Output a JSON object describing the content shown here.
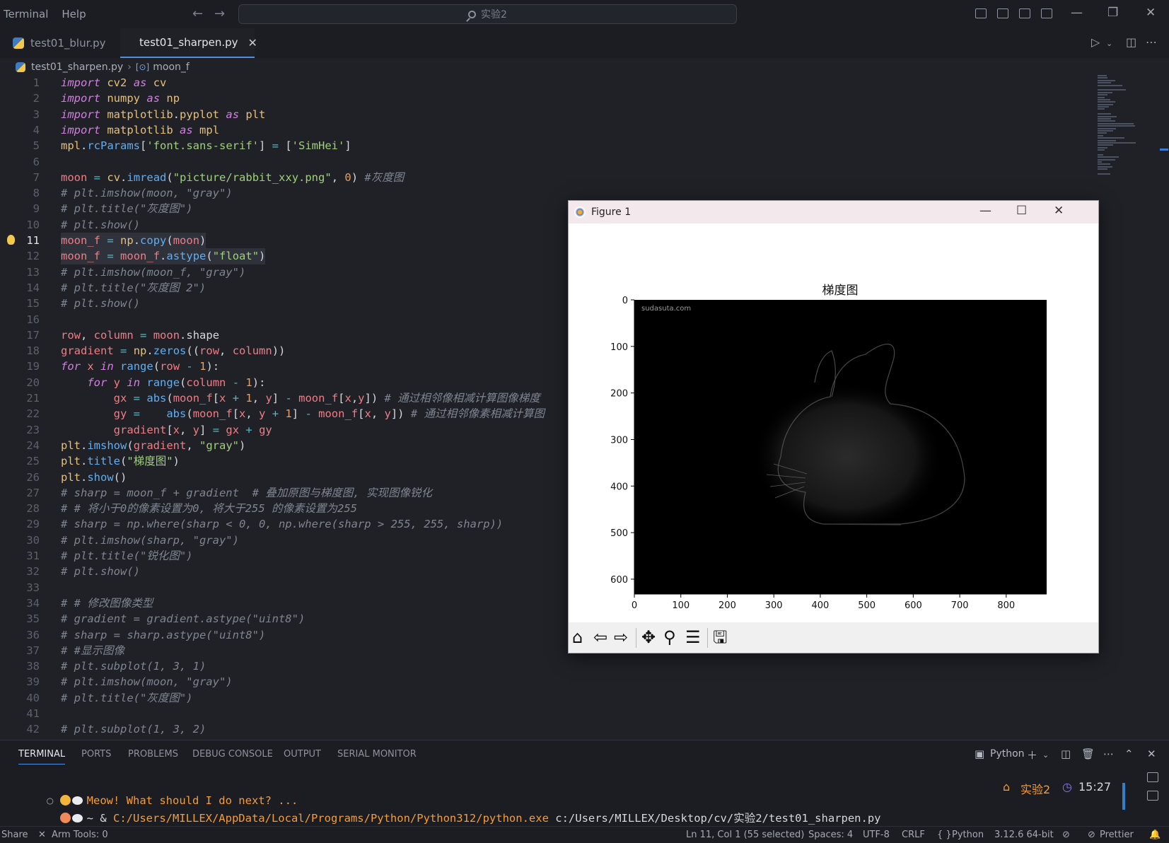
{
  "titlebar": {
    "menus": [
      "Terminal",
      "Help"
    ],
    "search_text": "实验2"
  },
  "tabs": [
    {
      "label": "test01_blur.py",
      "active": false
    },
    {
      "label": "test01_sharpen.py",
      "active": true
    }
  ],
  "breadcrumb": {
    "file": "test01_sharpen.py",
    "symbol": "moon_f"
  },
  "editor": {
    "current_line": 11,
    "lines": [
      "import cv2 as cv",
      "import numpy as np",
      "import matplotlib.pyplot as plt",
      "import matplotlib as mpl",
      "mpl.rcParams['font.sans-serif'] = ['SimHei']",
      "",
      "moon = cv.imread(\"picture/rabbit_xxy.png\", 0) #灰度图",
      "# plt.imshow(moon, \"gray\")",
      "# plt.title(\"灰度图\")",
      "# plt.show()",
      "moon_f = np.copy(moon)",
      "moon_f = moon_f.astype(\"float\")",
      "# plt.imshow(moon_f, \"gray\")",
      "# plt.title(\"灰度图 2\")",
      "# plt.show()",
      "",
      "row, column = moon.shape",
      "gradient = np.zeros((row, column))",
      "for x in range(row - 1):",
      "    for y in range(column - 1):",
      "        gx = abs(moon_f[x + 1, y] - moon_f[x,y]) # 通过相邻像相减计算图像梯度",
      "        gy =    abs(moon_f[x, y + 1] - moon_f[x, y]) # 通过相邻像素相减计算图",
      "        gradient[x, y] = gx + gy",
      "plt.imshow(gradient, \"gray\")",
      "plt.title(\"梯度图\")",
      "plt.show()",
      "# sharp = moon_f + gradient  # 叠加原图与梯度图, 实现图像锐化",
      "# # 将小于0的像素设置为0, 将大于255 的像素设置为255",
      "# sharp = np.where(sharp < 0, 0, np.where(sharp > 255, 255, sharp))",
      "# plt.imshow(sharp, \"gray\")",
      "# plt.title(\"锐化图\")",
      "# plt.show()",
      "",
      "# # 修改图像类型",
      "# gradient = gradient.astype(\"uint8\")",
      "# sharp = sharp.astype(\"uint8\")",
      "# #显示图像",
      "# plt.subplot(1, 3, 1)",
      "# plt.imshow(moon, \"gray\")",
      "# plt.title(\"灰度图\")",
      "",
      "# plt.subplot(1, 3, 2)"
    ]
  },
  "figure": {
    "window_title": "Figure 1",
    "plot_title": "梯度图",
    "watermark": "sudasuta.com",
    "toolbar": [
      "home",
      "back",
      "forward",
      "pan",
      "zoom",
      "configure",
      "save"
    ]
  },
  "chart_data": {
    "type": "image",
    "title": "梯度图",
    "xticks": [
      0,
      100,
      200,
      300,
      400,
      500,
      600,
      700,
      800
    ],
    "yticks": [
      0,
      100,
      200,
      300,
      400,
      500,
      600
    ],
    "xlim": [
      0,
      887
    ],
    "ylim": [
      632,
      0
    ],
    "colormap": "gray",
    "content": "gradient magnitude image of a rabbit silhouette on black background"
  },
  "panel": {
    "tabs": [
      "TERMINAL",
      "PORTS",
      "PROBLEMS",
      "DEBUG CONSOLE",
      "OUTPUT",
      "SERIAL MONITOR"
    ],
    "active_tab": "TERMINAL",
    "shell_label": "Python",
    "prompt_message": "Meow! What should I do next? ...",
    "command_prefix": "~ & ",
    "command_exe": "C:/Users/MILLEX/AppData/Local/Programs/Python/Python312/python.exe",
    "command_arg": " c:/Users/MILLEX/Desktop/cv/实验2/test01_sharpen.py",
    "folder": "实验2",
    "time": "15:27"
  },
  "statusbar": {
    "share": "Share",
    "arm_tools": "Arm Tools: 0",
    "position": "Ln 11, Col 1 (55 selected)",
    "spaces": "Spaces: 4",
    "encoding": "UTF-8",
    "eol": "CRLF",
    "language": "Python",
    "interpreter": "3.12.6 64-bit",
    "prettier": "Prettier"
  },
  "colors": {
    "accent": "#4f8fe0",
    "editor_bg": "#1f2127",
    "keyword": "#d27fe0",
    "string": "#9fd07a",
    "comment": "#7e8590",
    "terminal_prompt": "#f39c3d"
  }
}
